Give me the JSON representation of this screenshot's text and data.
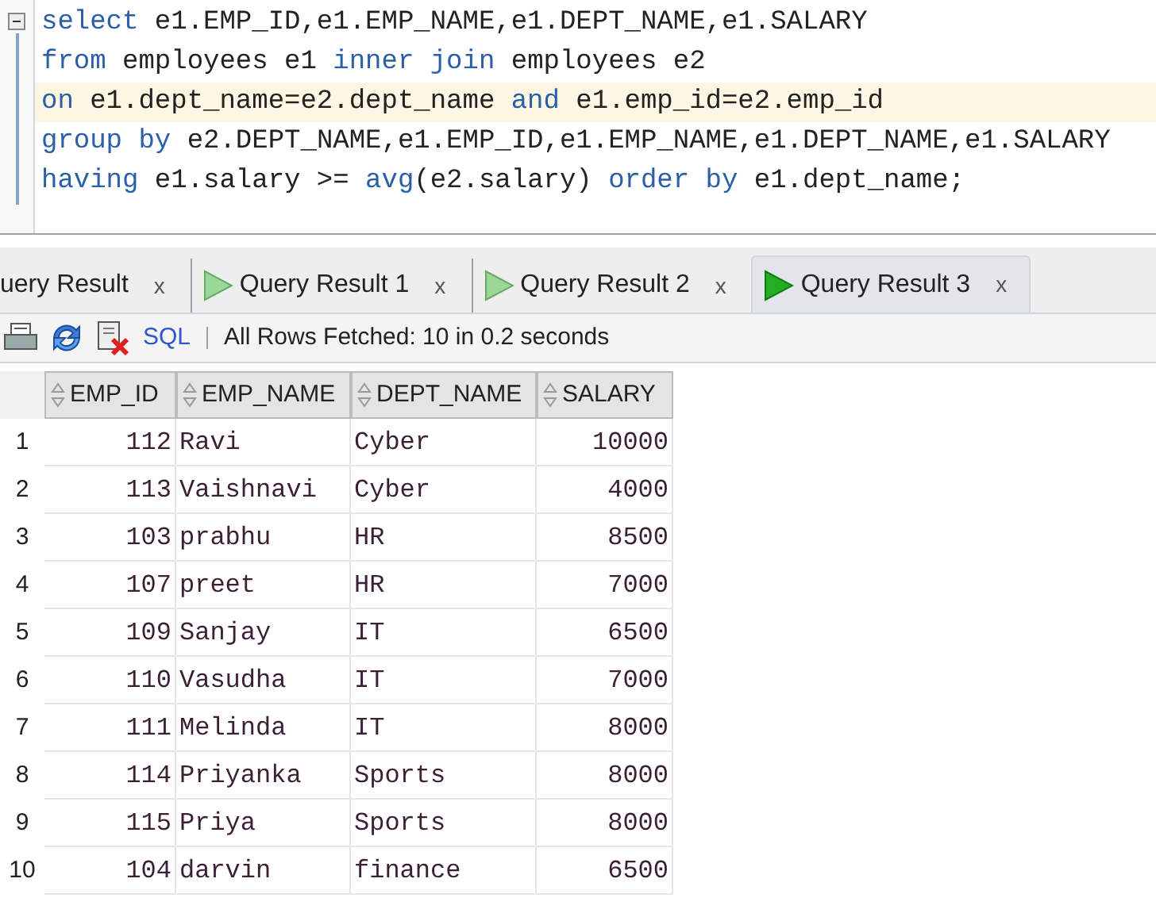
{
  "editor": {
    "lines": [
      {
        "current": false,
        "tokens": [
          {
            "kind": "keyword",
            "text": "select"
          },
          {
            "kind": "plain",
            "text": " e1.EMP_ID,e1.EMP_NAME,e1.DEPT_NAME,e1.SALARY"
          }
        ]
      },
      {
        "current": false,
        "tokens": [
          {
            "kind": "keyword",
            "text": "from"
          },
          {
            "kind": "plain",
            "text": " employees e1 "
          },
          {
            "kind": "keyword",
            "text": "inner join"
          },
          {
            "kind": "plain",
            "text": " employees e2"
          }
        ]
      },
      {
        "current": true,
        "tokens": [
          {
            "kind": "keyword",
            "text": "on"
          },
          {
            "kind": "plain",
            "text": " e1.dept_name=e2.dept_name "
          },
          {
            "kind": "keyword",
            "text": "and"
          },
          {
            "kind": "plain",
            "text": " e1.emp_id=e2.emp_id"
          }
        ]
      },
      {
        "current": false,
        "tokens": [
          {
            "kind": "keyword",
            "text": "group by"
          },
          {
            "kind": "plain",
            "text": " e2.DEPT_NAME,e1.EMP_ID,e1.EMP_NAME,e1.DEPT_NAME,e1.SALARY"
          }
        ]
      },
      {
        "current": false,
        "tokens": [
          {
            "kind": "keyword",
            "text": "having"
          },
          {
            "kind": "plain",
            "text": " e1.salary >= "
          },
          {
            "kind": "keyword",
            "text": "avg"
          },
          {
            "kind": "plain",
            "text": "(e2.salary) "
          },
          {
            "kind": "keyword",
            "text": "order by"
          },
          {
            "kind": "plain",
            "text": " e1.dept_name;"
          }
        ]
      }
    ]
  },
  "tabs": [
    {
      "label": "uery Result",
      "selected": false,
      "icon": false,
      "close": "x"
    },
    {
      "label": "Query Result 1",
      "selected": false,
      "icon": true,
      "close": "x"
    },
    {
      "label": "Query Result 2",
      "selected": false,
      "icon": true,
      "close": "x"
    },
    {
      "label": "Query Result 3",
      "selected": true,
      "icon": true,
      "close": "x"
    }
  ],
  "toolbar": {
    "sql": "SQL",
    "status": "All Rows Fetched: 10 in 0.2 seconds"
  },
  "table": {
    "columns": [
      {
        "label": "EMP_ID",
        "kind": "number"
      },
      {
        "label": "EMP_NAME",
        "kind": "text"
      },
      {
        "label": "DEPT_NAME",
        "kind": "text"
      },
      {
        "label": "SALARY",
        "kind": "number"
      }
    ],
    "rows": [
      {
        "number": "1",
        "cells": [
          "112",
          "Ravi",
          "Cyber",
          "10000"
        ]
      },
      {
        "number": "2",
        "cells": [
          "113",
          "Vaishnavi",
          "Cyber",
          "4000"
        ]
      },
      {
        "number": "3",
        "cells": [
          "103",
          "prabhu",
          "HR",
          "8500"
        ]
      },
      {
        "number": "4",
        "cells": [
          "107",
          "preet",
          "HR",
          "7000"
        ]
      },
      {
        "number": "5",
        "cells": [
          "109",
          "Sanjay",
          "IT",
          "6500"
        ]
      },
      {
        "number": "6",
        "cells": [
          "110",
          "Vasudha",
          "IT",
          "7000"
        ]
      },
      {
        "number": "7",
        "cells": [
          "111",
          "Melinda",
          "IT",
          "8000"
        ]
      },
      {
        "number": "8",
        "cells": [
          "114",
          "Priyanka",
          "Sports",
          "8000"
        ]
      },
      {
        "number": "9",
        "cells": [
          "115",
          "Priya",
          "Sports",
          "8000"
        ]
      },
      {
        "number": "10",
        "cells": [
          "104",
          "darvin",
          "finance",
          "6500"
        ]
      }
    ]
  }
}
